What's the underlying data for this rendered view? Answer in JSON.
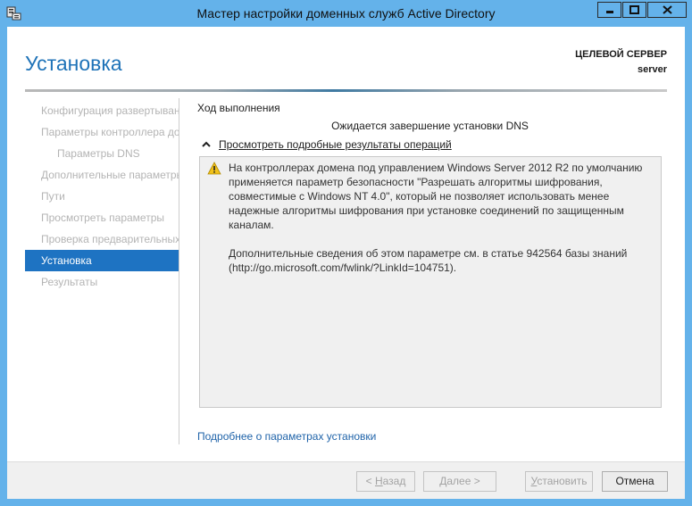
{
  "window": {
    "title": "Мастер настройки доменных служб Active Directory"
  },
  "header": {
    "page_title": "Установка",
    "target_label": "ЦЕЛЕВОЙ СЕРВЕР",
    "target_name": "server"
  },
  "sidebar": {
    "items": [
      {
        "label": "Конфигурация развертывания",
        "state": "disabled"
      },
      {
        "label": "Параметры контроллера домена",
        "state": "disabled"
      },
      {
        "label": "Параметры DNS",
        "state": "disabled"
      },
      {
        "label": "Дополнительные параметры",
        "state": "disabled"
      },
      {
        "label": "Пути",
        "state": "disabled"
      },
      {
        "label": "Просмотреть параметры",
        "state": "disabled"
      },
      {
        "label": "Проверка предварительных требований",
        "state": "disabled"
      },
      {
        "label": "Установка",
        "state": "active"
      },
      {
        "label": "Результаты",
        "state": "disabled"
      }
    ]
  },
  "main": {
    "progress_label": "Ход выполнения",
    "status_text": "Ожидается завершение установки DNS",
    "details_toggle_label": "Просмотреть подробные результаты операций",
    "details_message": "На контроллерах домена под управлением Windows Server 2012 R2 по умолчанию применяется параметр безопасности \"Разрешать алгоритмы шифрования, совместимые с Windows NT 4.0\", который не позволяет использовать менее надежные алгоритмы шифрования при установке соединений по защищенным каналам.\n\nДополнительные сведения об этом параметре см. в статье 942564 базы знаний (http://go.microsoft.com/fwlink/?LinkId=104751).",
    "more_link": "Подробнее о параметрах установки"
  },
  "footer": {
    "back_prefix": "< ",
    "back_key": "Н",
    "back_rest": "азад",
    "next_key": "Д",
    "next_rest": "алее >",
    "install_key": "У",
    "install_rest": "становить",
    "cancel_label": "Отмена"
  },
  "colors": {
    "accent": "#1e73c2",
    "title_bar": "#64b2ea",
    "link": "#1f63a9",
    "warning": "#f2c21b"
  }
}
